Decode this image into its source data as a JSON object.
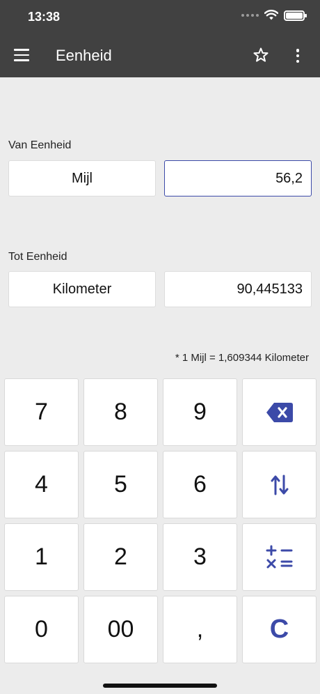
{
  "status_bar": {
    "time": "13:38"
  },
  "app_bar": {
    "title": "Eenheid",
    "icons": [
      "menu-icon",
      "star-icon",
      "more-vert-icon"
    ]
  },
  "from": {
    "label": "Van Eenheid",
    "unit": "Mijl",
    "value": "56,2"
  },
  "to": {
    "label": "Tot Eenheid",
    "unit": "Kilometer",
    "value": "90,445133"
  },
  "conversion_note": "* 1 Mijl = 1,609344 Kilometer",
  "keypad": {
    "k7": "7",
    "k8": "8",
    "k9": "9",
    "k4": "4",
    "k5": "5",
    "k6": "6",
    "k1": "1",
    "k2": "2",
    "k3": "3",
    "k0": "0",
    "k00": "00",
    "comma": ",",
    "clear": "C",
    "icons": [
      "backspace-icon",
      "swap-icon",
      "operators-icon"
    ]
  },
  "colors": {
    "app_bar": "#414141",
    "background": "#ececec",
    "accent": "#3c4aa8"
  }
}
